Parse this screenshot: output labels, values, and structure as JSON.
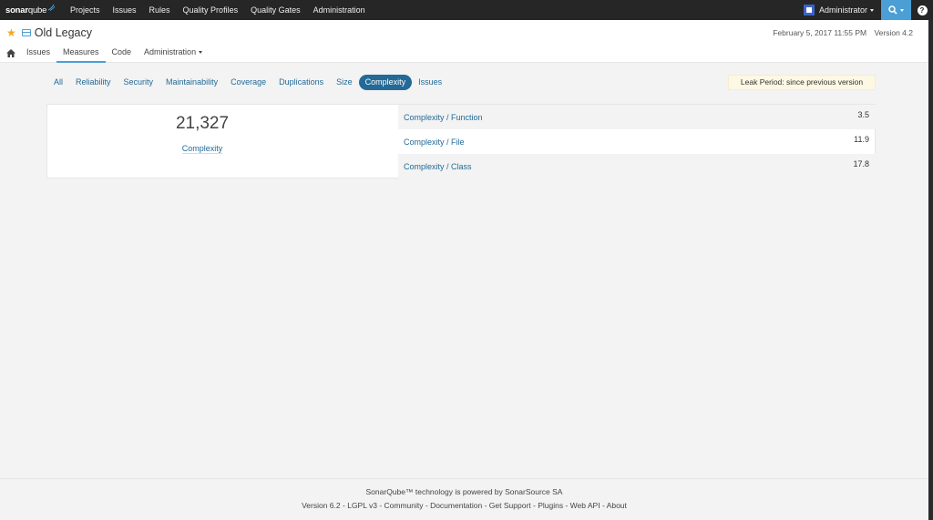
{
  "topnav": {
    "logo_sonar": "sonar",
    "logo_qube": "qube",
    "items": [
      "Projects",
      "Issues",
      "Rules",
      "Quality Profiles",
      "Quality Gates",
      "Administration"
    ],
    "user": "Administrator",
    "help": "?"
  },
  "project": {
    "title": "Old Legacy",
    "date": "February 5, 2017 11:55 PM",
    "version": "Version 4.2",
    "nav": [
      "Issues",
      "Measures",
      "Code",
      "Administration"
    ]
  },
  "domains": {
    "tabs": [
      "All",
      "Reliability",
      "Security",
      "Maintainability",
      "Coverage",
      "Duplications",
      "Size",
      "Complexity",
      "Issues"
    ],
    "active": "Complexity",
    "leak_period": "Leak Period: since previous version"
  },
  "measures": {
    "main_value": "21,327",
    "main_label": "Complexity",
    "rows": [
      {
        "name": "Complexity / Function",
        "value": "3.5"
      },
      {
        "name": "Complexity / File",
        "value": "11.9"
      },
      {
        "name": "Complexity / Class",
        "value": "17.8"
      }
    ]
  },
  "footer": {
    "line1_prefix": "SonarQube™ technology is powered by ",
    "line1_link": "SonarSource SA",
    "version": "Version 6.2",
    "links": [
      "LGPL v3",
      "Community",
      "Documentation",
      "Get Support",
      "Plugins",
      "Web API",
      "About"
    ]
  },
  "colors": {
    "topnav_bg": "#262626",
    "link": "#236a97",
    "search_bg": "#4b9fd5",
    "leak_bg": "#fcf8e3",
    "star": "#f4a623"
  }
}
